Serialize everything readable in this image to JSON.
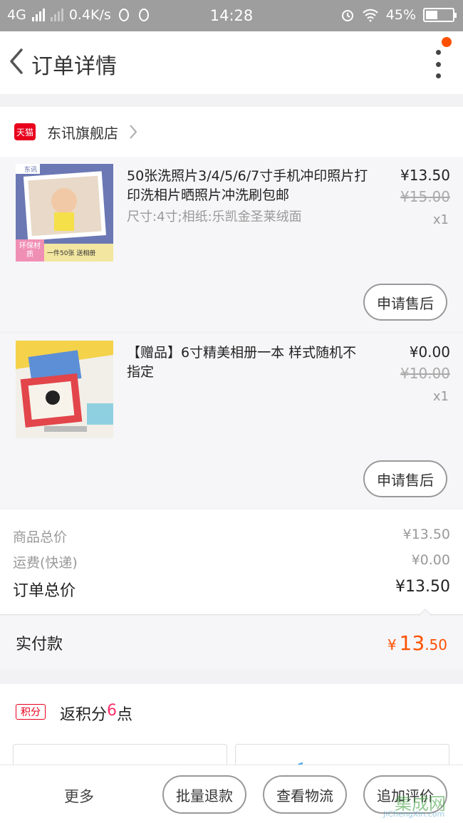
{
  "status_bar": {
    "network": "4G",
    "speed": "0.4K/s",
    "time": "14:28",
    "battery": "45%",
    "battery_fraction": 0.45
  },
  "nav": {
    "title": "订单详情"
  },
  "shop": {
    "badge": "天猫",
    "name": "东讯旗舰店"
  },
  "items": [
    {
      "thumb_brand": "东讯",
      "thumb_tag": "环保材质",
      "thumb_caption": "一件50张 送相册",
      "title": "50张洗照片3/4/5/6/7寸手机冲印照片打印洗相片晒照片冲洗刷包邮",
      "sku": "尺寸:4寸;相纸:乐凯金圣莱绒面",
      "price": "¥13.50",
      "original_price": "¥15.00",
      "quantity": "x1",
      "after_sale_label": "申请售后"
    },
    {
      "title": "【赠品】6寸精美相册一本  样式随机不指定",
      "price": "¥0.00",
      "original_price": "¥10.00",
      "quantity": "x1",
      "after_sale_label": "申请售后"
    }
  ],
  "summary": {
    "goods_total_label": "商品总价",
    "goods_total": "¥13.50",
    "shipping_label": "运费(快递)",
    "shipping": "¥0.00",
    "order_total_label": "订单总价",
    "order_total": "¥13.50"
  },
  "paid": {
    "label": "实付款",
    "currency": "¥",
    "integer": "13",
    "decimal": ".50"
  },
  "points": {
    "badge": "积分",
    "text_before": "返积分",
    "value": "6",
    "text_after": "点"
  },
  "bottom_bar": {
    "more": "更多",
    "batch_refund": "批量退款",
    "view_logistics": "查看物流",
    "add_review": "追加评价"
  },
  "watermark": {
    "main": "集成网",
    "sub": "JiChengXin.com"
  },
  "colors": {
    "accent": "#ff5000",
    "tmall_red": "#e8001c",
    "points_pink": "#ff2f6a"
  }
}
